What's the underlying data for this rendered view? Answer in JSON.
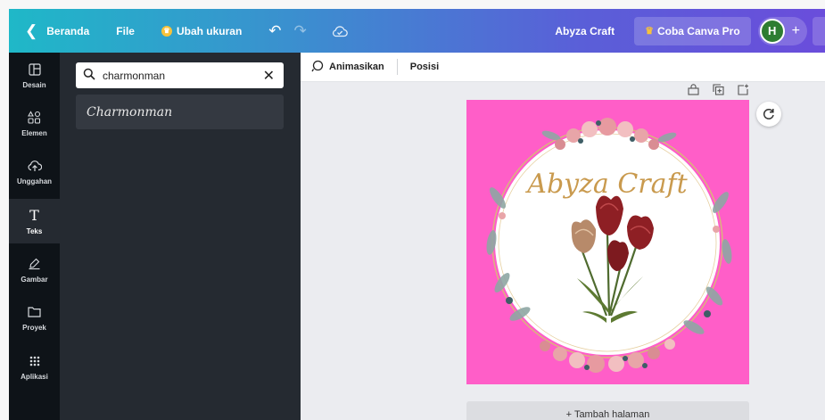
{
  "topbar": {
    "back_icon": "chevron-left-icon",
    "home_label": "Beranda",
    "file_label": "File",
    "resize_label": "Ubah ukuran",
    "project_name": "Abyza Craft",
    "pro_label": "Coba Canva Pro",
    "avatar_initial": "H",
    "colors": {
      "gradient_start": "#1fb8c8",
      "gradient_end": "#6a4ddb",
      "crown": "#f7c23a",
      "avatar": "#2e7d32"
    }
  },
  "rail": {
    "items": [
      {
        "label": "Desain",
        "icon": "layout-icon"
      },
      {
        "label": "Elemen",
        "icon": "shapes-icon"
      },
      {
        "label": "Unggahan",
        "icon": "upload-cloud-icon"
      },
      {
        "label": "Teks",
        "icon": "text-icon",
        "active": true
      },
      {
        "label": "Gambar",
        "icon": "draw-icon"
      },
      {
        "label": "Proyek",
        "icon": "folder-icon"
      },
      {
        "label": "Aplikasi",
        "icon": "apps-grid-icon"
      }
    ]
  },
  "panel": {
    "search_value": "charmonman",
    "result_font": "Charmonman"
  },
  "toolbar": {
    "animate_label": "Animasikan",
    "position_label": "Posisi"
  },
  "design": {
    "title_text": "Abyza Craft",
    "background_color": "#ff5ec8"
  },
  "add_page_label": "+ Tambah halaman"
}
